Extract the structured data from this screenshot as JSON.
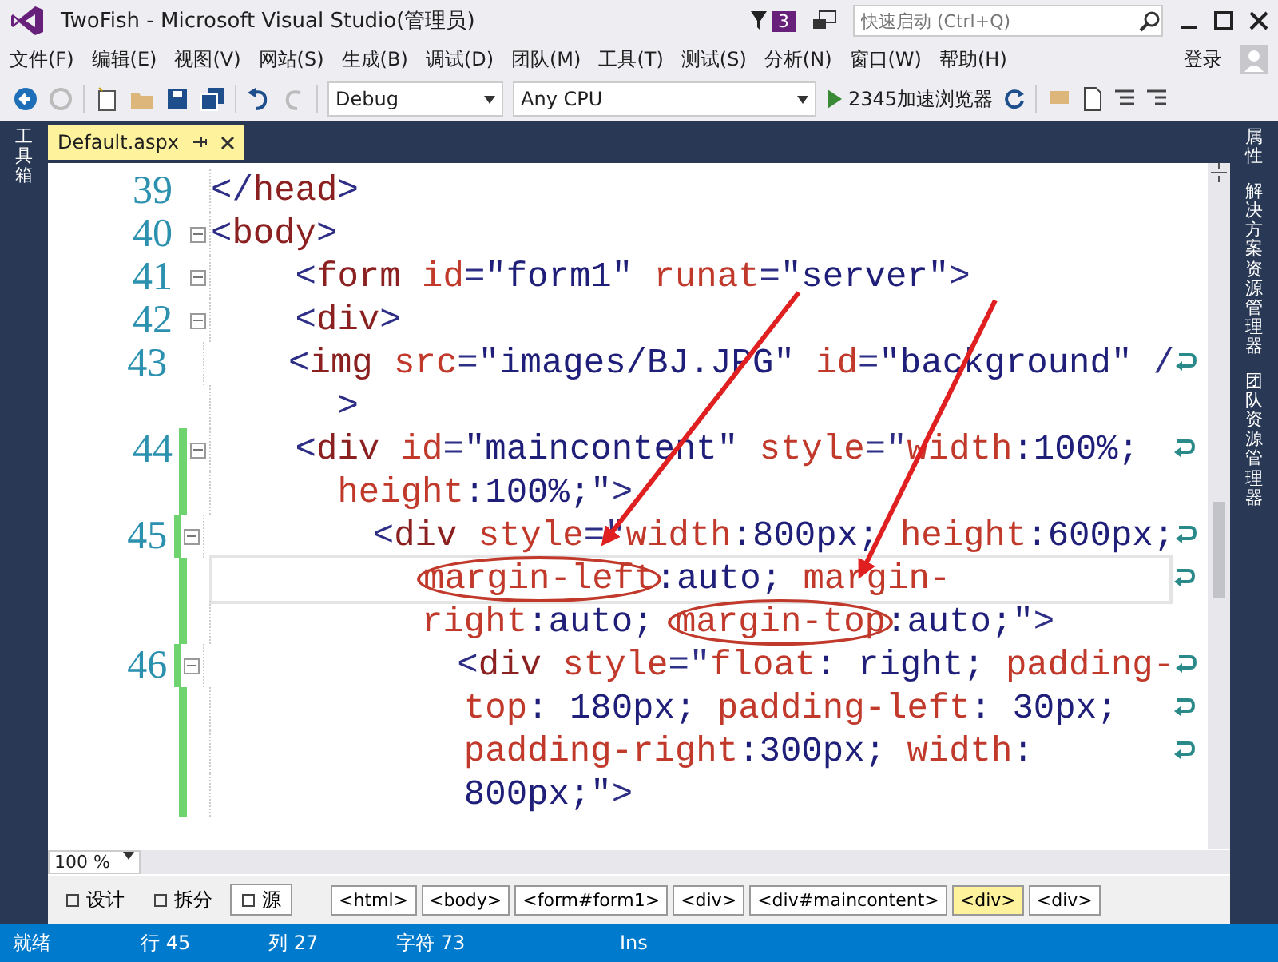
{
  "window": {
    "title": "TwoFish - Microsoft Visual Studio(管理员)",
    "notification_count": "3",
    "quick_launch": {
      "placeholder": "快速启动 (Ctrl+Q)"
    }
  },
  "menu": [
    "文件(F)",
    "编辑(E)",
    "视图(V)",
    "网站(S)",
    "生成(B)",
    "调试(D)",
    "团队(M)",
    "工具(T)",
    "测试(S)",
    "分析(N)",
    "窗口(W)",
    "帮助(H)"
  ],
  "sign_in": "登录",
  "toolbar": {
    "configuration": "Debug",
    "platform": "Any CPU",
    "browser": "2345加速浏览器"
  },
  "left_panel_tabs": [
    "工具箱"
  ],
  "right_panel_tabs": [
    "属性",
    "解决方案资源管理器",
    "团队资源管理器"
  ],
  "document_tabs": [
    {
      "label": "Default.aspx",
      "selected": true
    }
  ],
  "editor": {
    "zoom": "100 %",
    "lines": [
      {
        "number": "39",
        "foldable": false,
        "changed": false,
        "rows": [
          {
            "current": false,
            "segs": [
              {
                "kind": "delim",
                "text": "</"
              },
              {
                "kind": "tag",
                "text": "head"
              },
              {
                "kind": "delim",
                "text": ">"
              }
            ]
          }
        ]
      },
      {
        "number": "40",
        "foldable": true,
        "changed": false,
        "rows": [
          {
            "current": false,
            "segs": [
              {
                "kind": "delim",
                "text": "<"
              },
              {
                "kind": "tag",
                "text": "body"
              },
              {
                "kind": "delim",
                "text": ">"
              }
            ]
          }
        ]
      },
      {
        "number": "41",
        "foldable": true,
        "changed": false,
        "rows": [
          {
            "current": false,
            "segs": [
              {
                "kind": "delim",
                "text": "    <"
              },
              {
                "kind": "tag",
                "text": "form"
              },
              {
                "kind": "attr",
                "text": " id"
              },
              {
                "kind": "delim",
                "text": "="
              },
              {
                "kind": "value",
                "text": "\"form1\""
              },
              {
                "kind": "attr",
                "text": " runat"
              },
              {
                "kind": "delim",
                "text": "="
              },
              {
                "kind": "value",
                "text": "\"server\""
              },
              {
                "kind": "delim",
                "text": ">"
              }
            ]
          }
        ]
      },
      {
        "number": "42",
        "foldable": true,
        "changed": false,
        "rows": [
          {
            "current": false,
            "segs": [
              {
                "kind": "delim",
                "text": "    <"
              },
              {
                "kind": "tag",
                "text": "div"
              },
              {
                "kind": "delim",
                "text": ">"
              }
            ]
          }
        ]
      },
      {
        "number": "43",
        "foldable": false,
        "changed": false,
        "rows": [
          {
            "current": false,
            "segs": [
              {
                "kind": "delim",
                "text": "    <"
              },
              {
                "kind": "tag",
                "text": "img"
              },
              {
                "kind": "attr",
                "text": " src"
              },
              {
                "kind": "delim",
                "text": "="
              },
              {
                "kind": "value",
                "text": "\"images/BJ.JPG\""
              },
              {
                "kind": "attr",
                "text": " id"
              },
              {
                "kind": "delim",
                "text": "="
              },
              {
                "kind": "value",
                "text": "\"background\""
              },
              {
                "kind": "delim",
                "text": " /"
              }
            ]
          },
          {
            "current": false,
            "segs": [
              {
                "kind": "delim",
                "text": "      >"
              }
            ]
          }
        ]
      },
      {
        "number": "44",
        "foldable": true,
        "changed": true,
        "rows": [
          {
            "current": false,
            "segs": [
              {
                "kind": "delim",
                "text": "    <"
              },
              {
                "kind": "tag",
                "text": "div"
              },
              {
                "kind": "attr",
                "text": " id"
              },
              {
                "kind": "delim",
                "text": "="
              },
              {
                "kind": "value",
                "text": "\"maincontent\""
              },
              {
                "kind": "attr",
                "text": " style"
              },
              {
                "kind": "delim",
                "text": "=\""
              },
              {
                "kind": "attr",
                "text": "width"
              },
              {
                "kind": "value",
                "text": ":100%;"
              }
            ]
          },
          {
            "current": false,
            "segs": [
              {
                "kind": "attr",
                "text": "      height"
              },
              {
                "kind": "value",
                "text": ":100%;\""
              },
              {
                "kind": "delim",
                "text": ">"
              }
            ]
          }
        ]
      },
      {
        "number": "45",
        "foldable": true,
        "changed": true,
        "rows": [
          {
            "current": false,
            "segs": [
              {
                "kind": "delim",
                "text": "        <"
              },
              {
                "kind": "tag",
                "text": "div"
              },
              {
                "kind": "attr",
                "text": " style"
              },
              {
                "kind": "delim",
                "text": "=\""
              },
              {
                "kind": "attr",
                "text": "width"
              },
              {
                "kind": "value",
                "text": ":800px; "
              },
              {
                "kind": "attr",
                "text": "height"
              },
              {
                "kind": "value",
                "text": ":600px;"
              }
            ]
          },
          {
            "current": true,
            "segs": [
              {
                "kind": "circled",
                "text": "          margin-left"
              },
              {
                "kind": "value",
                "text": ":auto; "
              },
              {
                "kind": "attr",
                "text": "margin-"
              }
            ]
          },
          {
            "current": false,
            "segs": [
              {
                "kind": "attr",
                "text": "          right"
              },
              {
                "kind": "value",
                "text": ":auto; "
              },
              {
                "kind": "circled",
                "text": "margin-top"
              },
              {
                "kind": "value",
                "text": ":auto;\""
              },
              {
                "kind": "delim",
                "text": ">"
              }
            ]
          }
        ]
      },
      {
        "number": "46",
        "foldable": true,
        "changed": true,
        "rows": [
          {
            "current": false,
            "segs": [
              {
                "kind": "delim",
                "text": "            <"
              },
              {
                "kind": "tag",
                "text": "div"
              },
              {
                "kind": "attr",
                "text": " style"
              },
              {
                "kind": "delim",
                "text": "=\""
              },
              {
                "kind": "attr",
                "text": "float"
              },
              {
                "kind": "value",
                "text": ": right; "
              },
              {
                "kind": "attr",
                "text": "padding-"
              }
            ]
          },
          {
            "current": false,
            "segs": [
              {
                "kind": "attr",
                "text": "            top"
              },
              {
                "kind": "value",
                "text": ": 180px; "
              },
              {
                "kind": "attr",
                "text": "padding-left"
              },
              {
                "kind": "value",
                "text": ": 30px;"
              }
            ]
          },
          {
            "current": false,
            "segs": [
              {
                "kind": "attr",
                "text": "            padding-right"
              },
              {
                "kind": "value",
                "text": ":300px; "
              },
              {
                "kind": "attr",
                "text": "width"
              },
              {
                "kind": "value",
                "text": ":"
              }
            ]
          },
          {
            "current": false,
            "segs": [
              {
                "kind": "value",
                "text": "            800px;\""
              },
              {
                "kind": "delim",
                "text": ">"
              }
            ]
          }
        ]
      }
    ]
  },
  "view_buttons": [
    {
      "label": "设计",
      "selected": false
    },
    {
      "label": "拆分",
      "selected": false
    },
    {
      "label": "源",
      "selected": true
    }
  ],
  "breadcrumb": [
    {
      "label": "<html>",
      "selected": false
    },
    {
      "label": "<body>",
      "selected": false
    },
    {
      "label": "<form#form1>",
      "selected": false
    },
    {
      "label": "<div>",
      "selected": false
    },
    {
      "label": "<div#maincontent>",
      "selected": false
    },
    {
      "label": "<div>",
      "selected": true
    },
    {
      "label": "<div>",
      "selected": false
    }
  ],
  "status_bar": {
    "state": "就绪",
    "line": "行 45",
    "column": "列 27",
    "char": "字符 73",
    "mode": "Ins"
  }
}
